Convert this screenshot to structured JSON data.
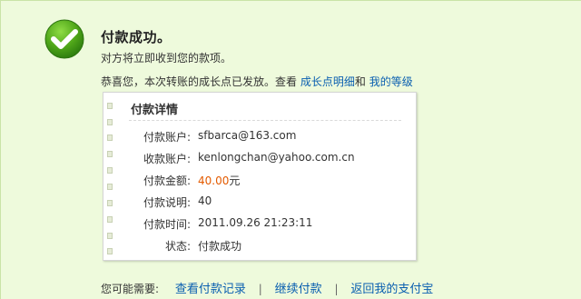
{
  "status": {
    "title": "付款成功。",
    "message": "对方将立即收到您的款项。",
    "success_color": "#4fa619",
    "icon": "check-circle-icon"
  },
  "growth": {
    "text": "恭喜您，本次转账的成长点已发放。查看",
    "link_detail": "成长点明细",
    "and_text": "和",
    "link_level": "我的等级"
  },
  "details": {
    "title": "付款详情",
    "rows": [
      {
        "label": "付款账户:",
        "value": "sfbarca@163.com"
      },
      {
        "label": "收款账户:",
        "value": "kenlongchan@yahoo.com.cn"
      },
      {
        "label": "付款金额:",
        "value": "40.00",
        "unit": "元",
        "value_color": "#e35a00"
      },
      {
        "label": "付款说明:",
        "value": "40"
      },
      {
        "label": "付款时间:",
        "value": "2011.09.26 21:23:11"
      },
      {
        "label": "状态:",
        "value": "付款成功"
      }
    ]
  },
  "footer": {
    "prompt": "您可能需要:",
    "links": [
      "查看付款记录",
      "继续付款",
      "返回我的支付宝"
    ],
    "separator": "|"
  }
}
